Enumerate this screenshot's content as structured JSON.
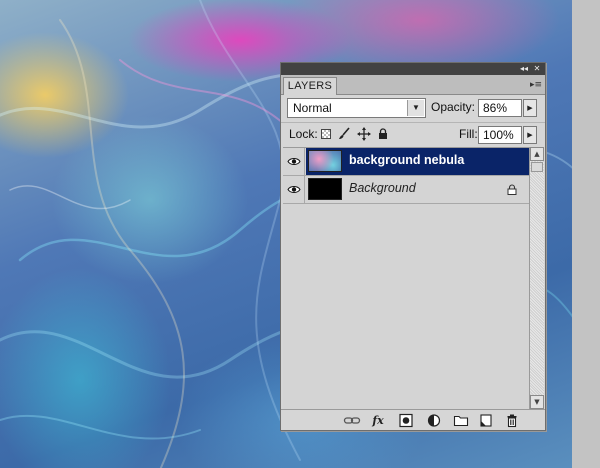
{
  "panel": {
    "tab_label": "LAYERS",
    "collapse_glyph": "◂◂",
    "close_glyph": "✕",
    "menu_glyph": "▸≡"
  },
  "blend": {
    "mode": "Normal",
    "opacity_label": "Opacity:",
    "opacity_value": "86%"
  },
  "lock": {
    "label": "Lock:",
    "fill_label": "Fill:",
    "fill_value": "100%"
  },
  "layers": [
    {
      "name": "background nebula",
      "selected": true,
      "visible": true,
      "locked": false
    },
    {
      "name": "Background",
      "selected": false,
      "visible": true,
      "locked": true
    }
  ],
  "colors": {
    "selection": "#0a2468",
    "panel_bg": "#d6d6d6",
    "header_bg": "#424242"
  },
  "icons": {
    "toolbar": [
      "link-icon",
      "fx-icon",
      "mask-icon",
      "adjustment-icon",
      "group-icon",
      "new-layer-icon",
      "trash-icon"
    ],
    "fx_text": "fx"
  }
}
